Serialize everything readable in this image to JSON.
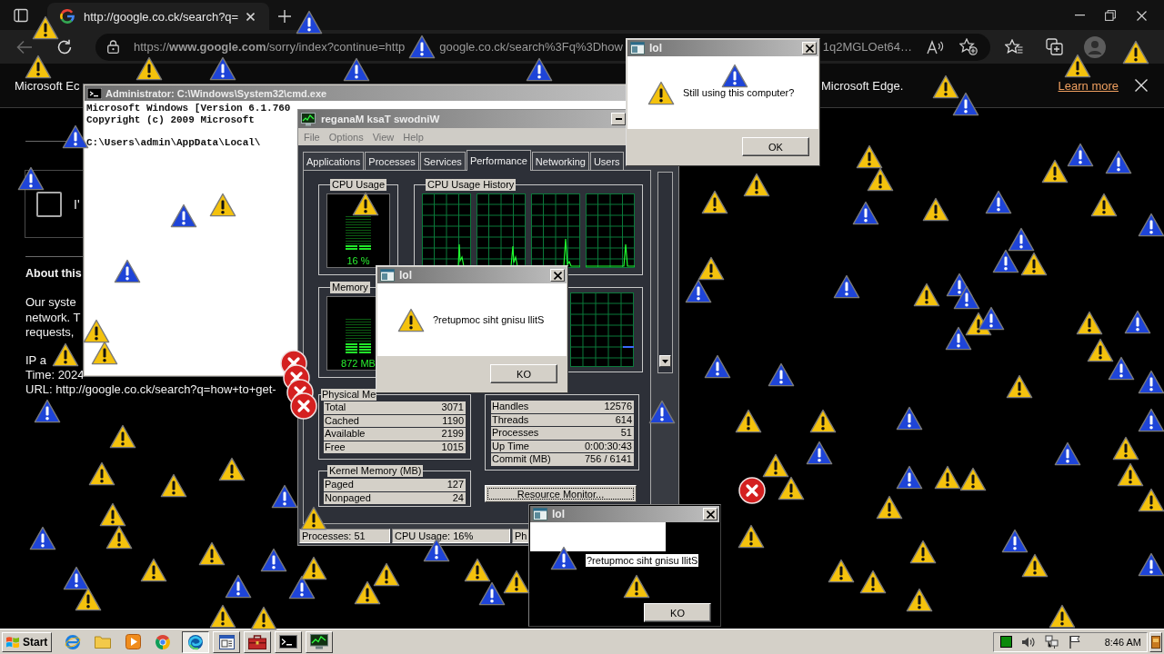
{
  "browser": {
    "tab": {
      "title": "http://google.co.ck/search?q="
    },
    "address_bar": {
      "fragments": [
        "https://**www.google.com**/sorry/index?continue=http",
        "google.co.ck/search%3Fq%3Dhow",
        "1q2MGLOet64…"
      ]
    },
    "infobar": {
      "text_start": "Microsoft Ec",
      "text_end": "Microsoft Edge.",
      "link": "Learn more"
    },
    "page": {
      "checkbox": {
        "label": "I'",
        "checked": false
      },
      "heading": "About this",
      "paragraph_lines": [
        "Our syste",
        "network. T",
        "requests,"
      ],
      "detail_lines": [
        "IP a",
        "Time: 2024",
        "URL: http://google.co.ck/search?q=how+to+get-"
      ]
    }
  },
  "cmd": {
    "title": "Administrator: C:\\Windows\\System32\\cmd.exe",
    "banner": [
      "Microsoft Windows [Version 6.1.760",
      "Copyright (c) 2009 Microsoft"
    ],
    "prompt": "C:\\Users\\admin\\AppData\\Local\\"
  },
  "task_manager": {
    "title": "reganaM ksaT swodniW",
    "menu": [
      "File",
      "Options",
      "View",
      "Help"
    ],
    "tabs": [
      {
        "label": "Applications",
        "selected": false
      },
      {
        "label": "Processes",
        "selected": false
      },
      {
        "label": "Services",
        "selected": false
      },
      {
        "label": "Performance",
        "selected": true
      },
      {
        "label": "Networking",
        "selected": false
      },
      {
        "label": "Users",
        "selected": false
      }
    ],
    "cpu_usage": {
      "title": "CPU Usage",
      "reading": "16 %",
      "level": 0.16
    },
    "cpu_history": {
      "title": "CPU Usage History"
    },
    "memory": {
      "title": "Memory",
      "reading": "872 MB",
      "level": 0.28
    },
    "physical_memory": {
      "title": "Physical Me",
      "rows": [
        {
          "label": "Total",
          "value": "3071"
        },
        {
          "label": "Cached",
          "value": "1190"
        },
        {
          "label": "Available",
          "value": "2199"
        },
        {
          "label": "Free",
          "value": "1015"
        }
      ]
    },
    "system": {
      "rows": [
        {
          "label": "Handles",
          "value": "12576"
        },
        {
          "label": "Threads",
          "value": "614"
        },
        {
          "label": "Processes",
          "value": "51"
        },
        {
          "label": "Up Time",
          "value": "0:00:30:43"
        },
        {
          "label": "Commit (MB)",
          "value": "756 / 6141"
        }
      ]
    },
    "kernel_memory": {
      "title": "Kernel Memory (MB)",
      "rows": [
        {
          "label": "Paged",
          "value": "127"
        },
        {
          "label": "Nonpaged",
          "value": "24"
        }
      ]
    },
    "resource_monitor_button": "Resource Monitor...",
    "status_bar": [
      "Processes: 51",
      "CPU Usage: 16%",
      "Ph"
    ]
  },
  "dialogs": [
    {
      "kind": "normal",
      "title": "lol",
      "message": "Still using this computer?",
      "button": "OK"
    },
    {
      "kind": "normal",
      "title": "lol",
      "message": "?retupmoc siht gnisu llitS",
      "button": "KO"
    },
    {
      "kind": "glitched",
      "title": "lol",
      "message": "?retupmoc siht gnisu llitS",
      "button": "KO"
    }
  ],
  "taskbar": {
    "start": "Start",
    "apps": [
      {
        "kind": "launcher",
        "selected": false
      },
      {
        "kind": "launcher",
        "selected": false
      },
      {
        "kind": "launcher",
        "selected": false
      },
      {
        "kind": "launcher",
        "selected": false
      },
      {
        "kind": "window",
        "selected": true
      },
      {
        "kind": "window",
        "selected": false
      },
      {
        "kind": "window",
        "selected": false
      },
      {
        "kind": "window",
        "selected": false
      },
      {
        "kind": "window",
        "selected": false
      }
    ],
    "clock": "8:46 AM"
  }
}
